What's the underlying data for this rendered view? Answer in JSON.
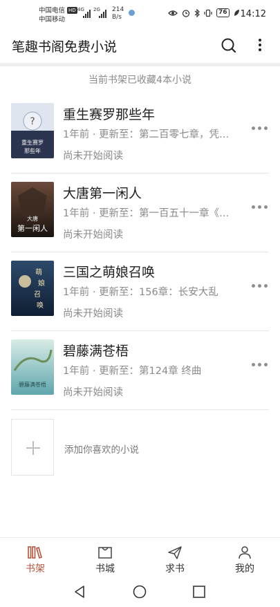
{
  "status_bar": {
    "carrier1": "中国电信",
    "carrier1_badge": "HD",
    "carrier2": "中国移动",
    "net1": "4G",
    "net2": "2G",
    "speed_value": "214",
    "speed_unit": "B/s",
    "battery": "76",
    "time": "14:12"
  },
  "app_bar": {
    "title": "笔趣书阁免费小说",
    "icons": [
      "search-icon",
      "more-vertical-icon"
    ]
  },
  "shelf": {
    "summary": "当前书架已收藏4本小说",
    "books": [
      {
        "title": "重生赛罗那些年",
        "meta": "1年前 · 更新至：第二百零七章，凭…",
        "progress": "尚未开始阅读",
        "cover_text": "重生赛罗\n那些年",
        "cover_colors": [
          "#cfd6e6",
          "#2c3550"
        ]
      },
      {
        "title": "大唐第一闲人",
        "meta": "1年前 · 更新至：第一百五十一章《…",
        "progress": "尚未开始阅读",
        "cover_text": "大唐\n第一闲人",
        "cover_colors": [
          "#6b4a3a",
          "#1a1410"
        ]
      },
      {
        "title": "三国之萌娘召唤",
        "meta": "1年前 · 更新至：156章：长安大乱",
        "progress": "尚未开始阅读",
        "cover_text": "萌\n娘\n召\n唤",
        "cover_colors": [
          "#2d4a6b",
          "#0f1e33"
        ]
      },
      {
        "title": "碧藤满苍梧",
        "meta": "1年前 · 更新至：第124章 终曲",
        "progress": "尚未开始阅读",
        "cover_text": "碧藤满苍梧",
        "cover_colors": [
          "#b8dcd8",
          "#5fa6ad"
        ]
      }
    ],
    "add_label": "添加你喜欢的小说"
  },
  "tabs": [
    {
      "label": "书架",
      "icon": "bookshelf-icon",
      "active": true
    },
    {
      "label": "书城",
      "icon": "bookstore-icon",
      "active": false
    },
    {
      "label": "求书",
      "icon": "paper-plane-icon",
      "active": false
    },
    {
      "label": "我的",
      "icon": "user-icon",
      "active": false
    }
  ],
  "colors": {
    "accent": "#b4553a",
    "muted_text": "#8a8a8a",
    "divider": "#e6e6e6"
  },
  "nav_bar": {
    "icons": [
      "back-icon",
      "home-icon",
      "recents-icon"
    ]
  }
}
